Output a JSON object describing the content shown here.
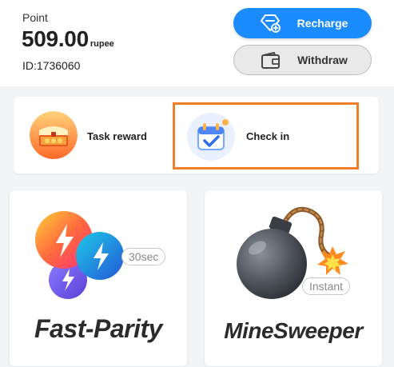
{
  "wallet": {
    "point_label": "Point",
    "balance": "509.00",
    "unit": "rupee",
    "user_id": "ID:1736060"
  },
  "actions": {
    "recharge_label": "Recharge",
    "withdraw_label": "Withdraw"
  },
  "tasks": [
    {
      "label": "Task reward",
      "icon": "treasure-chest-icon"
    },
    {
      "label": "Check in",
      "icon": "calendar-check-icon",
      "highlighted": true
    }
  ],
  "games": [
    {
      "title": "Fast-Parity",
      "badge": "30sec",
      "icon": "lightning-orbs-icon"
    },
    {
      "title": "MineSweeper",
      "badge": "Instant",
      "icon": "bomb-icon"
    }
  ],
  "colors": {
    "primary": "#1a8cff",
    "highlight": "#ef7d2a",
    "background": "#f3f4f6"
  }
}
